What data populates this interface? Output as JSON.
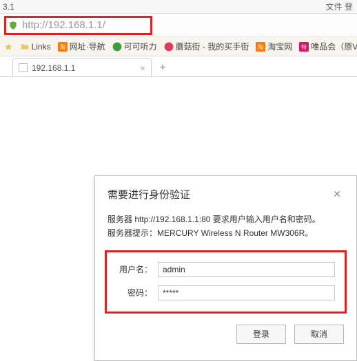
{
  "topbar": {
    "partial_left": "3.1",
    "right": "文件    登"
  },
  "address": {
    "url": "http://192.168.1.1/"
  },
  "bookmarks": {
    "items": [
      {
        "label": "Links"
      },
      {
        "label": "网址·导航"
      },
      {
        "label": "可可听力"
      },
      {
        "label": "蘑菇街 - 我的买手街"
      },
      {
        "label": "淘宝网"
      },
      {
        "label": "唯品会（原V"
      }
    ]
  },
  "tab": {
    "title": "192.168.1.1"
  },
  "dialog": {
    "title": "需要进行身份验证",
    "line1": "服务器 http://192.168.1.1:80 要求用户输入用户名和密码。",
    "line2": "服务器提示：MERCURY Wireless N Router MW306R。",
    "username_label": "用户名：",
    "username_value": "admin",
    "password_label": "密码：",
    "password_value": "*****",
    "login": "登录",
    "cancel": "取消"
  }
}
